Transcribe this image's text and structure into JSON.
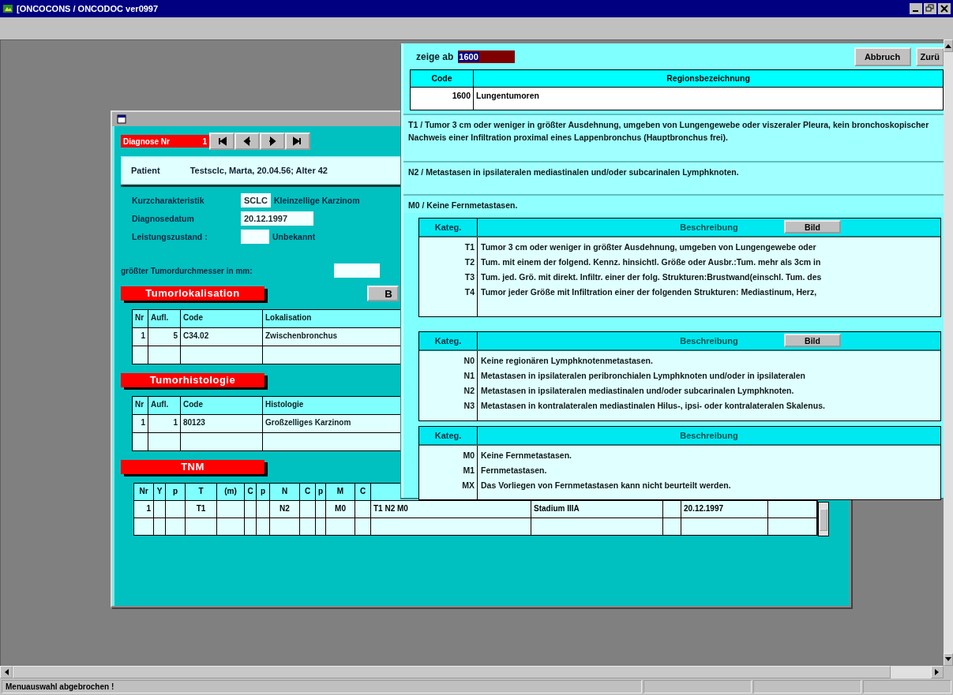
{
  "window": {
    "title": "[ONCOCONS / ONCODOC ver0997"
  },
  "diagnosis_window": {
    "diagnose_label": "Diagnose Nr",
    "diagnose_number": "1",
    "nav_buttons": [
      {
        "kind": "first"
      },
      {
        "kind": "prev"
      },
      {
        "kind": "next"
      },
      {
        "kind": "last"
      }
    ],
    "patient": {
      "label": "Patient",
      "value": "Testsclc, Marta, 20.04.56; Alter 42"
    },
    "fields": [
      {
        "label": "Kurzcharakteristik",
        "value": "SCLC",
        "note": "Kleinzellige Karzinom"
      },
      {
        "label": "Diagnosedatum",
        "value": "20.12.1997"
      },
      {
        "label": "Leistungszustand :",
        "note": "Unbekannt"
      }
    ],
    "diameter_label": "größter Tumordurchmesser in mm:",
    "localization": {
      "title": "Tumorlokalisation",
      "button": "B",
      "columns": [
        "Nr",
        "Aufl.",
        "Code",
        "Lokalisation"
      ],
      "rows": [
        [
          "1",
          "5",
          "C34.02",
          "Zwischenbronchus"
        ]
      ]
    },
    "histology": {
      "title": "Tumorhistologie",
      "columns": [
        "Nr",
        "Aufl.",
        "Code",
        "Histologie"
      ],
      "rows": [
        [
          "1",
          "1",
          "80123",
          "Großzelliges Karzinom"
        ]
      ]
    },
    "tnm": {
      "title": "TNM",
      "columns": [
        "Nr",
        "Y",
        "p",
        "T",
        "(m)",
        "C",
        "p",
        "N",
        "C",
        "p",
        "M",
        "C"
      ],
      "rows": [
        {
          "nr": "1",
          "t": "T1",
          "n": "N2",
          "m": "M0",
          "tnm": "T1 N2 M0",
          "stage": "Stadium IIIA",
          "date": "20.12.1997"
        }
      ]
    }
  },
  "lookup_panel": {
    "show_from_label": "zeige ab",
    "show_from_value": "1600",
    "buttons": [
      "Abbruch",
      "Zurü"
    ],
    "region_columns": [
      "Code",
      "Regionsbezeichnung"
    ],
    "region_rows": [
      [
        "1600",
        "Lungentumoren"
      ]
    ],
    "selections": [
      "T1 / Tumor 3 cm oder weniger in größter Ausdehnung, umgeben von Lungengewebe oder viszeraler Pleura, kein bronchoskopischer Nachweis einer Infiltration proximal eines Lappenbronchus (Hauptbronchus frei).",
      "N2 / Metastasen in ipsilateralen mediastinalen und/oder subcarinalen Lymphknoten.",
      "M0 / Keine Fernmetastasen."
    ],
    "category_tables": [
      {
        "columns": [
          "Kateg.",
          "Beschreibung"
        ],
        "button": "Bild",
        "rows": [
          {
            "code": "T1",
            "text": "Tumor 3 cm oder weniger in größter Ausdehnung, umgeben von Lungengewebe oder"
          },
          {
            "code": "T2",
            "text": "Tum. mit einem der folgend. Kennz. hinsichtl. Größe oder Ausbr.:Tum. mehr als 3cm in"
          },
          {
            "code": "T3",
            "text": "Tum. jed. Grö. mit direkt. Infiltr. einer der folg. Strukturen:Brustwand(einschl. Tum. des"
          },
          {
            "code": "T4",
            "text": "Tumor jeder Größe mit Infiltration einer der folgenden Strukturen: Mediastinum, Herz,"
          }
        ]
      },
      {
        "columns": [
          "Kateg.",
          "Beschreibung"
        ],
        "button": "Bild",
        "rows": [
          {
            "code": "N0",
            "text": "Keine regionären Lymphknotenmetastasen."
          },
          {
            "code": "N1",
            "text": "Metastasen in ipsilateralen peribronchialen Lymphknoten und/oder in ipsilateralen"
          },
          {
            "code": "N2",
            "text": "Metastasen in ipsilateralen mediastinalen und/oder subcarinalen Lymphknoten."
          },
          {
            "code": "N3",
            "text": "Metastasen in kontralateralen mediastinalen Hilus-, ipsi- oder kontralateralen Skalenus."
          }
        ]
      },
      {
        "columns": [
          "Kateg.",
          "Beschreibung"
        ],
        "rows": [
          {
            "code": "M0",
            "text": "Keine Fernmetastasen."
          },
          {
            "code": "M1",
            "text": "Fernmetastasen."
          },
          {
            "code": "MX",
            "text": "Das Vorliegen von Fernmetastasen kann nicht beurteilt werden."
          }
        ]
      }
    ]
  },
  "status_bar": {
    "message": "Menuauswahl abgebrochen !"
  }
}
